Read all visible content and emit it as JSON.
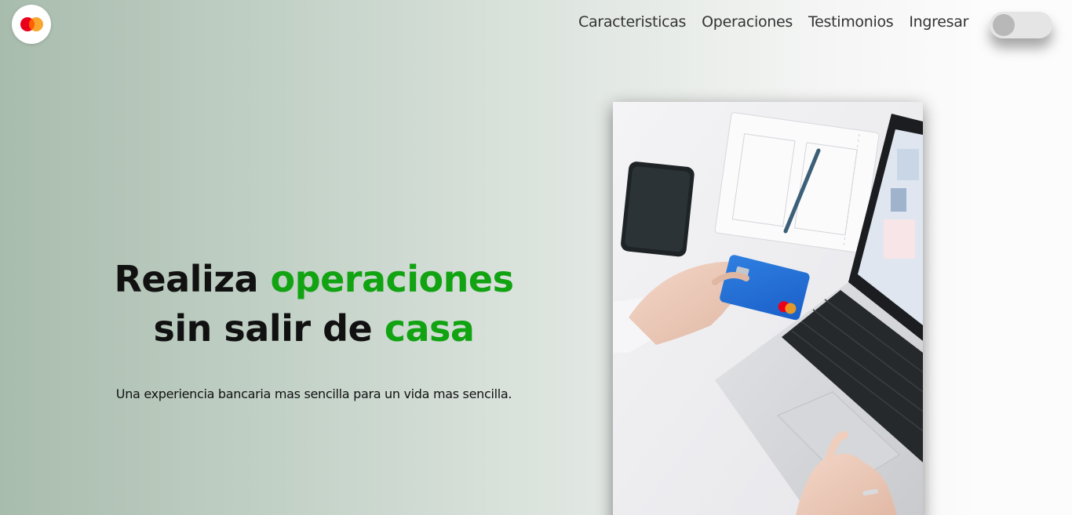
{
  "brand": {
    "logo_icon": "mastercard-logo-icon",
    "colors": {
      "red": "#eb001b",
      "orange": "#f79e1b"
    }
  },
  "nav": {
    "items": [
      {
        "label": "Caracteristicas"
      },
      {
        "label": "Operaciones"
      },
      {
        "label": "Testimonios"
      },
      {
        "label": "Ingresar"
      }
    ]
  },
  "theme_toggle": {
    "state": "off",
    "icon": "toggle-switch-icon"
  },
  "hero": {
    "title_part1": "Realiza ",
    "title_highlight1": "operaciones",
    "title_part2": " sin salir de ",
    "title_highlight2": "casa",
    "subtitle": "Una experiencia bancaria mas sencilla para un vida mas sencilla.",
    "accent_color": "#11a311"
  },
  "hero_image": {
    "subject": "hand-holding-credit-card-over-laptop-image"
  }
}
